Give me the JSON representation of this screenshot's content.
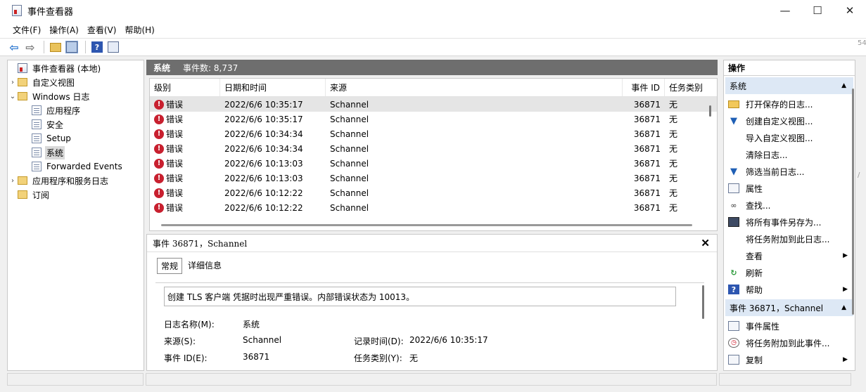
{
  "window": {
    "title": "事件查看器",
    "minimize": "—",
    "maximize": "☐",
    "close": "✕"
  },
  "menu": [
    {
      "label": "文件(F)"
    },
    {
      "label": "操作(A)"
    },
    {
      "label": "查看(V)"
    },
    {
      "label": "帮助(H)"
    }
  ],
  "tree": {
    "root": "事件查看器 (本地)",
    "custom_views": "自定义视图",
    "windows_logs": "Windows 日志",
    "logs": [
      "应用程序",
      "安全",
      "Setup",
      "系统",
      "Forwarded Events"
    ],
    "app_service_logs": "应用程序和服务日志",
    "subscriptions": "订阅"
  },
  "center": {
    "title": "系统",
    "count_label": "事件数: 8,737"
  },
  "list": {
    "headers": {
      "level": "级别",
      "datetime": "日期和时间",
      "source": "来源",
      "event_id": "事件 ID",
      "task": "任务类别"
    },
    "rows": [
      {
        "level": "错误",
        "datetime": "2022/6/6 10:35:17",
        "source": "Schannel",
        "event_id": "36871",
        "task": "无"
      },
      {
        "level": "错误",
        "datetime": "2022/6/6 10:35:17",
        "source": "Schannel",
        "event_id": "36871",
        "task": "无"
      },
      {
        "level": "错误",
        "datetime": "2022/6/6 10:34:34",
        "source": "Schannel",
        "event_id": "36871",
        "task": "无"
      },
      {
        "level": "错误",
        "datetime": "2022/6/6 10:34:34",
        "source": "Schannel",
        "event_id": "36871",
        "task": "无"
      },
      {
        "level": "错误",
        "datetime": "2022/6/6 10:13:03",
        "source": "Schannel",
        "event_id": "36871",
        "task": "无"
      },
      {
        "level": "错误",
        "datetime": "2022/6/6 10:13:03",
        "source": "Schannel",
        "event_id": "36871",
        "task": "无"
      },
      {
        "level": "错误",
        "datetime": "2022/6/6 10:12:22",
        "source": "Schannel",
        "event_id": "36871",
        "task": "无"
      },
      {
        "level": "错误",
        "datetime": "2022/6/6 10:12:22",
        "source": "Schannel",
        "event_id": "36871",
        "task": "无"
      }
    ]
  },
  "detail": {
    "title": "事件 36871，Schannel",
    "close": "✕",
    "tab_general": "常规",
    "tab_details": "详细信息",
    "description": "创建 TLS 客户端 凭据时出现严重错误。内部错误状态为 10013。",
    "log_name_label": "日志名称(M):",
    "log_name": "系统",
    "source_label": "来源(S):",
    "source": "Schannel",
    "logged_label": "记录时间(D):",
    "logged": "2022/6/6 10:35:17",
    "event_id_label": "事件 ID(E):",
    "event_id": "36871",
    "task_label": "任务类别(Y):",
    "task": "无"
  },
  "actions": {
    "title": "操作",
    "section1": "系统",
    "items1": [
      {
        "label": "打开保存的日志...",
        "icon": "folder-icon"
      },
      {
        "label": "创建自定义视图...",
        "icon": "filter-icon"
      },
      {
        "label": "导入自定义视图...",
        "icon": ""
      },
      {
        "label": "清除日志...",
        "icon": ""
      },
      {
        "label": "筛选当前日志...",
        "icon": "filter-icon"
      },
      {
        "label": "属性",
        "icon": "properties-icon"
      },
      {
        "label": "查找...",
        "icon": "binoculars-icon"
      },
      {
        "label": "将所有事件另存为...",
        "icon": "save-icon"
      },
      {
        "label": "将任务附加到此日志...",
        "icon": ""
      },
      {
        "label": "查看",
        "icon": "",
        "submenu": true
      },
      {
        "label": "刷新",
        "icon": "refresh-icon"
      },
      {
        "label": "帮助",
        "icon": "help-icon",
        "submenu": true
      }
    ],
    "section2": "事件 36871，Schannel",
    "items2": [
      {
        "label": "事件属性",
        "icon": "properties-icon"
      },
      {
        "label": "将任务附加到此事件...",
        "icon": "task-icon"
      },
      {
        "label": "复制",
        "icon": "copy-icon",
        "submenu": true
      }
    ]
  },
  "right_fragments": {
    "top": "54",
    "mid": "/"
  }
}
